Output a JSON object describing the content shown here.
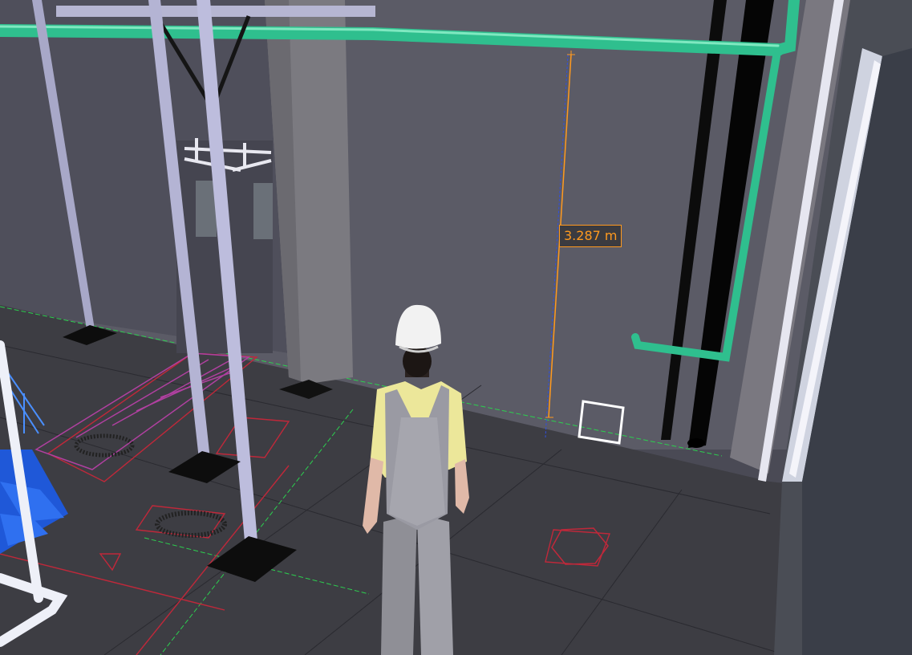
{
  "measurement": {
    "label": "3.287 m",
    "color": "#ff9a1f"
  },
  "scene": {
    "wall_color": "#5a5a66",
    "floor_color": "#3e3e44",
    "pipe_color": "#2fbf8e",
    "beam_color": "#b8b8d8"
  }
}
